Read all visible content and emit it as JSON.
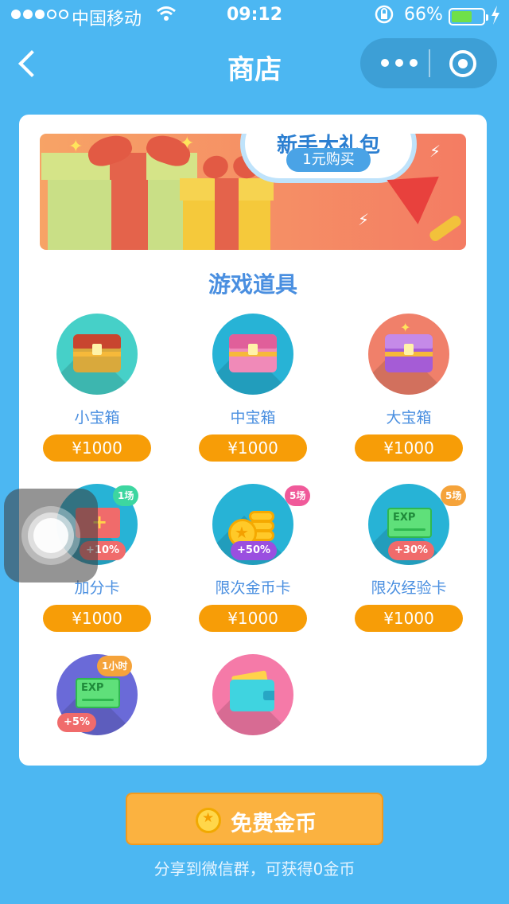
{
  "status_bar": {
    "carrier": "中国移动",
    "time": "09:12",
    "battery_percent": "66%",
    "battery_level": 0.66
  },
  "nav": {
    "title": "商店"
  },
  "banner": {
    "headline": "新手大礼包",
    "buy_label": "1元购买"
  },
  "section_title": "游戏道具",
  "items": [
    {
      "label": "小宝箱",
      "price": "¥1000",
      "icon": "small-chest-icon",
      "bg": "#46d0c8"
    },
    {
      "label": "中宝箱",
      "price": "¥1000",
      "icon": "medium-chest-icon",
      "bg": "#27b3d6"
    },
    {
      "label": "大宝箱",
      "price": "¥1000",
      "icon": "large-chest-icon",
      "bg": "#f0806a"
    },
    {
      "label": "加分卡",
      "price": "¥1000",
      "icon": "bonus-card-icon",
      "badge_top": "1场",
      "badge_bottom": "+10%"
    },
    {
      "label": "限次金币卡",
      "price": "¥1000",
      "icon": "coin-card-icon",
      "badge_top": "5场",
      "badge_bottom": "+50%"
    },
    {
      "label": "限次经验卡",
      "price": "¥1000",
      "icon": "exp-card-icon",
      "badge_top": "5场",
      "badge_bottom": "+30%",
      "card_text": "EXP"
    },
    {
      "icon": "exp-card-hour-icon",
      "badge_top": "1小时",
      "badge_bottom": "+5%",
      "card_text": "EXP"
    },
    {
      "icon": "wallet-icon"
    }
  ],
  "free_coins_button": "免费金币",
  "share_note": "分享到微信群，可获得0金币",
  "colors": {
    "page_bg": "#4cb7f2",
    "accent_text": "#4a8fe0",
    "price_pill": "#f79d07",
    "button": "#fbb240"
  }
}
